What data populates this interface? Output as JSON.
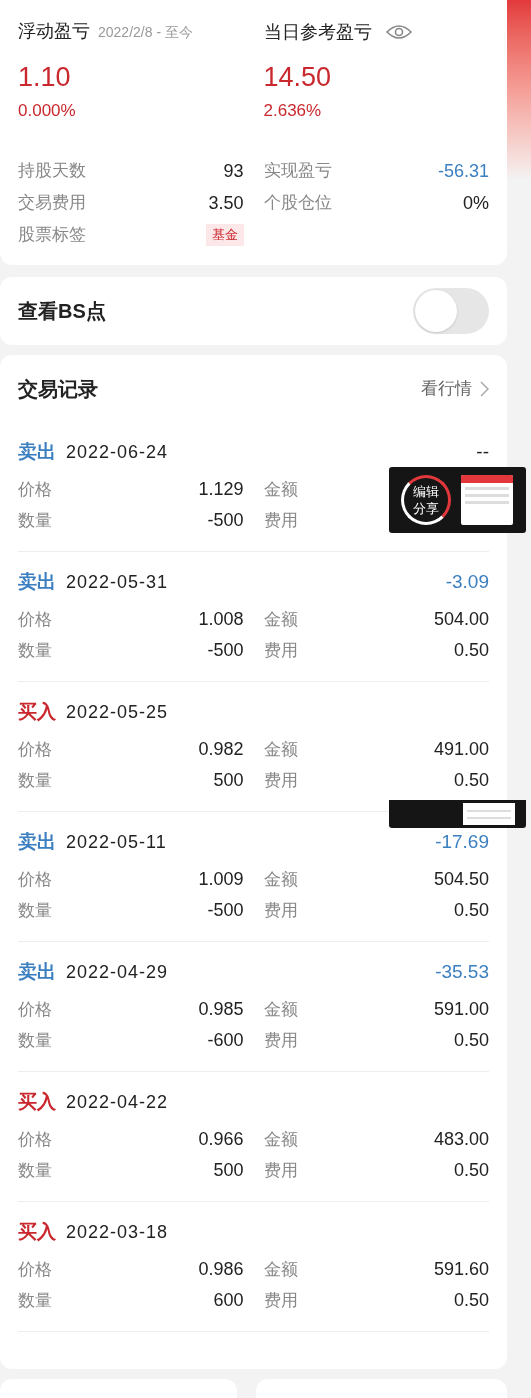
{
  "summary": {
    "floating": {
      "title": "浮动盈亏",
      "period": "2022/2/8 - 至今",
      "value": "1.10",
      "percent": "0.000%"
    },
    "daily": {
      "title": "当日参考盈亏",
      "value": "14.50",
      "percent": "2.636%"
    },
    "stats": [
      {
        "label": "持股天数",
        "value": "93",
        "kind": "plain"
      },
      {
        "label": "实现盈亏",
        "value": "-56.31",
        "kind": "loss"
      },
      {
        "label": "交易费用",
        "value": "3.50",
        "kind": "plain"
      },
      {
        "label": "个股仓位",
        "value": "0%",
        "kind": "plain"
      },
      {
        "label": "股票标签",
        "value": "基金",
        "kind": "tag"
      }
    ]
  },
  "bs_points": {
    "label": "查看BS点",
    "on": false
  },
  "records": {
    "title": "交易记录",
    "link": "看行情",
    "items": [
      {
        "kind": "sell",
        "type": "卖出",
        "date": "2022-06-24",
        "pnl": {
          "text": "--",
          "kind": "plain"
        },
        "fields": [
          {
            "label": "价格",
            "value": "1.129"
          },
          {
            "label": "金额"
          },
          {
            "label": "数量",
            "value": "-500"
          },
          {
            "label": "费用"
          }
        ]
      },
      {
        "kind": "sell",
        "type": "卖出",
        "date": "2022-05-31",
        "pnl": {
          "text": "-3.09",
          "kind": "loss"
        },
        "fields": [
          {
            "label": "价格",
            "value": "1.008"
          },
          {
            "label": "金额",
            "value": "504.00"
          },
          {
            "label": "数量",
            "value": "-500"
          },
          {
            "label": "费用",
            "value": "0.50"
          }
        ]
      },
      {
        "kind": "buy",
        "type": "买入",
        "date": "2022-05-25",
        "fields": [
          {
            "label": "价格",
            "value": "0.982"
          },
          {
            "label": "金额",
            "value": "491.00"
          },
          {
            "label": "数量",
            "value": "500"
          },
          {
            "label": "费用",
            "value": "0.50"
          }
        ]
      },
      {
        "kind": "sell",
        "type": "卖出",
        "date": "2022-05-11",
        "pnl": {
          "text": "-17.69",
          "kind": "loss"
        },
        "fields": [
          {
            "label": "价格",
            "value": "1.009"
          },
          {
            "label": "金额",
            "value": "504.50"
          },
          {
            "label": "数量",
            "value": "-500"
          },
          {
            "label": "费用",
            "value": "0.50"
          }
        ]
      },
      {
        "kind": "sell",
        "type": "卖出",
        "date": "2022-04-29",
        "pnl": {
          "text": "-35.53",
          "kind": "loss"
        },
        "fields": [
          {
            "label": "价格",
            "value": "0.985"
          },
          {
            "label": "金额",
            "value": "591.00"
          },
          {
            "label": "数量",
            "value": "-600"
          },
          {
            "label": "费用",
            "value": "0.50"
          }
        ]
      },
      {
        "kind": "buy",
        "type": "买入",
        "date": "2022-04-22",
        "fields": [
          {
            "label": "价格",
            "value": "0.966"
          },
          {
            "label": "金额",
            "value": "483.00"
          },
          {
            "label": "数量",
            "value": "500"
          },
          {
            "label": "费用",
            "value": "0.50"
          }
        ]
      },
      {
        "kind": "buy",
        "type": "买入",
        "date": "2022-03-18",
        "fields": [
          {
            "label": "价格",
            "value": "0.986"
          },
          {
            "label": "金额",
            "value": "591.60"
          },
          {
            "label": "数量",
            "value": "600"
          },
          {
            "label": "费用",
            "value": "0.50"
          }
        ]
      }
    ]
  },
  "share_overlay": {
    "lines": [
      "编辑",
      "分享"
    ]
  }
}
